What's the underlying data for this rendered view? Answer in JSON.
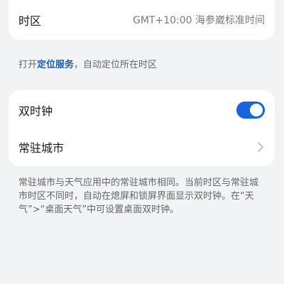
{
  "time_zone": {
    "label": "时区",
    "value": "GMT+10:00 海参崴标准时间"
  },
  "location_hint": {
    "prefix": "打开",
    "link": "定位服务",
    "suffix": "，自动定位所在时区"
  },
  "dual_clock": {
    "label": "双时钟",
    "enabled": true
  },
  "resident_city": {
    "label": "常驻城市"
  },
  "description": "常驻城市与天气应用中的常驻城市相同。当前时区与常驻城市时区不同时，自动在熄屏和锁屏界面显示双时钟。在“天气”>“桌面天气”中可设置桌面双时钟。",
  "colors": {
    "accent": "#1565e0",
    "link": "#1a5fb4"
  }
}
